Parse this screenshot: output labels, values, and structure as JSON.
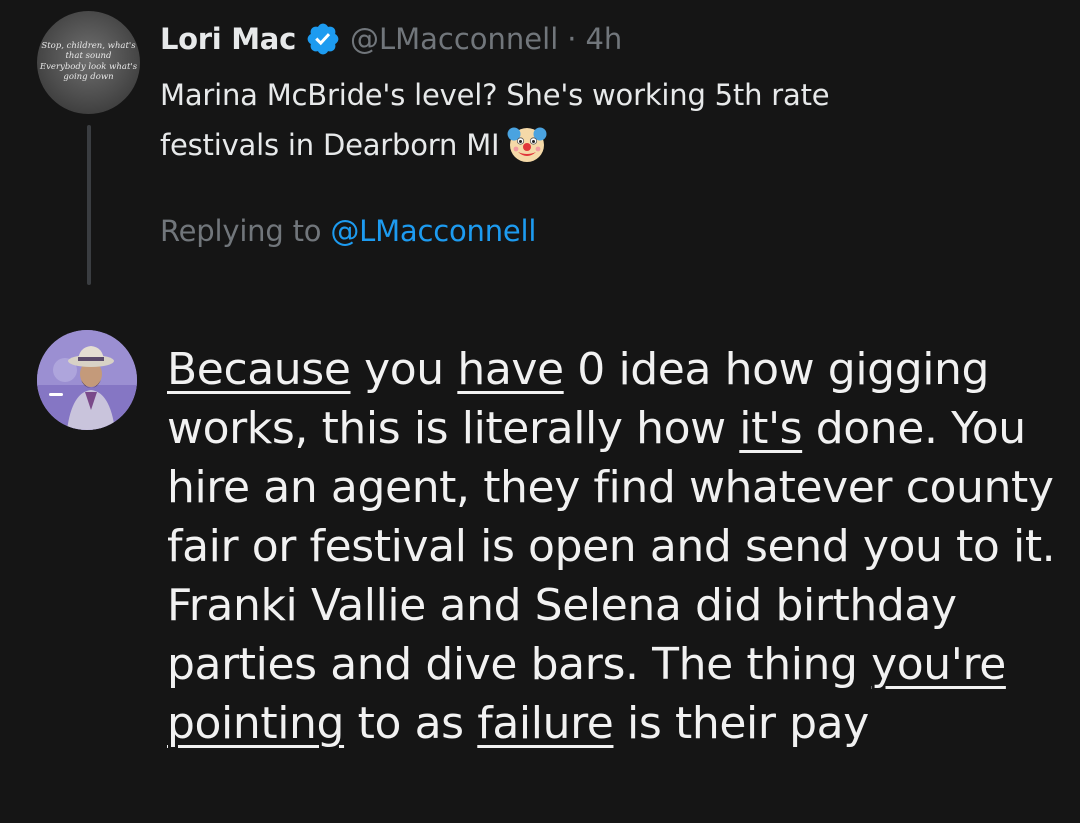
{
  "tweet": {
    "author": {
      "display_name": "Lori Mac",
      "handle": "@LMacconnell",
      "verified_icon": "verified-badge-icon",
      "avatar_text": [
        "Stop, children, what's",
        "that sound",
        "Everybody look what's",
        "going down"
      ]
    },
    "separator": "·",
    "time": "4h",
    "text_line1": "Marina McBride's level? She's working 5th rate",
    "text_line2": "festivals in Dearborn MI",
    "emoji": "clown-face-icon",
    "replying_prefix": "Replying to",
    "replying_handle": "@LMacconnell"
  },
  "reply": {
    "avatar": "user-avatar",
    "segments": [
      {
        "text": "Because",
        "underline": true
      },
      {
        "text": " you ",
        "underline": false
      },
      {
        "text": "have",
        "underline": true
      },
      {
        "text": " 0 idea how gigging works, this is literally how ",
        "underline": false
      },
      {
        "text": "it's",
        "underline": true
      },
      {
        "text": " done. You hire an agent, they find whatever county fair or festival is open and send you to it. Franki Vallie and Selena did birthday parties and dive bars. The thing ",
        "underline": false
      },
      {
        "text": "you're",
        "underline": true
      },
      {
        "text": " ",
        "underline": false
      },
      {
        "text": "pointing",
        "underline": true
      },
      {
        "text": " to as ",
        "underline": false
      },
      {
        "text": "failure",
        "underline": true
      },
      {
        "text": " is their pay",
        "underline": false
      }
    ]
  },
  "colors": {
    "background": "#151515",
    "primary_text": "#e7e9ea",
    "secondary_text": "#71767b",
    "link": "#1d9bf0",
    "verified": "#1d9bf0"
  }
}
